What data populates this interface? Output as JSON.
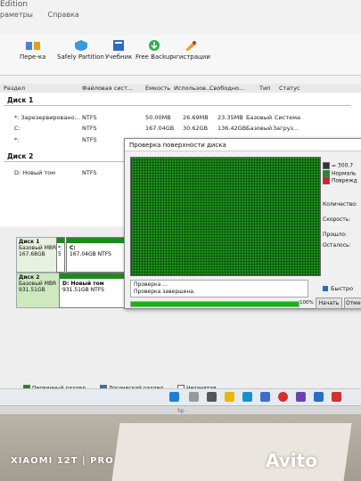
{
  "window": {
    "title_fragment": "Edition"
  },
  "menu": {
    "items": [
      "раметры",
      "Справка"
    ]
  },
  "toolbar": {
    "buttons": [
      {
        "label": "Пере-ка",
        "icon": "transfer-icon"
      },
      {
        "label": "Safely Partition",
        "icon": "safely-partition-icon"
      },
      {
        "label": "Учебник",
        "icon": "tutorial-icon"
      },
      {
        "label": "Free Backup",
        "icon": "backup-icon"
      },
      {
        "label": "чгистрации",
        "icon": "register-icon"
      }
    ]
  },
  "columns": [
    "Раздел",
    "Файловая сист...",
    "Емкость",
    "Использов...",
    "Свободно...",
    "Тип",
    "Статус"
  ],
  "disk_list": {
    "disk1_header": "Диск 1",
    "disk1_rows": [
      {
        "name": "*: Зарезервировано...",
        "fs": "NTFS",
        "cap": "50.00MB",
        "used": "26.69MB",
        "free": "23.35MB",
        "type": "Базовый",
        "status": "Система"
      },
      {
        "name": "C:",
        "fs": "NTFS",
        "cap": "167.04GB",
        "used": "30.62GB",
        "free": "136.42GB",
        "type": "Базовый",
        "status": "Загруз..."
      },
      {
        "name": "*:",
        "fs": "NTFS",
        "cap": "",
        "used": "",
        "free": "",
        "type": "",
        "status": ""
      }
    ],
    "disk2_header": "Диск 2",
    "disk2_rows": [
      {
        "name": "D: Новый том",
        "fs": "NTFS"
      }
    ]
  },
  "disk_map": {
    "disk1": {
      "title": "Диск 1",
      "type": "Базовый MBR",
      "size": "167.68GB",
      "part_letter": "C:",
      "part_size": "167.04GB NTFS",
      "left_letter": "*:",
      "left_num": "5"
    },
    "disk2": {
      "title": "Диск 2",
      "type": "Базовый MBR",
      "size": "931.51GB",
      "part_letter": "D: Новый том",
      "part_size": "931.51GB NTFS"
    }
  },
  "legend": {
    "items": [
      "Первичный раздел",
      "Логический раздел",
      "Незанятая"
    ]
  },
  "dialog": {
    "title": "Проверка поверхности диска",
    "side_legend": [
      "= 300.7",
      "Нормаль",
      "Поврежд"
    ],
    "side_fields": [
      "Количество:",
      "Скорость:",
      "Прошло:",
      "Осталось:"
    ],
    "status_lines": [
      "Проверка ...",
      "Проверка завершена."
    ],
    "progress_percent": 100,
    "progress_label": "100%",
    "checkbox_label": "Быстро",
    "start_button": "Начать",
    "cancel_button": "Отмена"
  },
  "monitor": {
    "brand": "hp"
  },
  "watermark": {
    "phone": "XIAOMI 12T | PRO",
    "site": "Avito"
  },
  "colors": {
    "good_sector": "#1f8f1f",
    "progress": "#12b812",
    "primary_partition": "#1c8a1c"
  }
}
